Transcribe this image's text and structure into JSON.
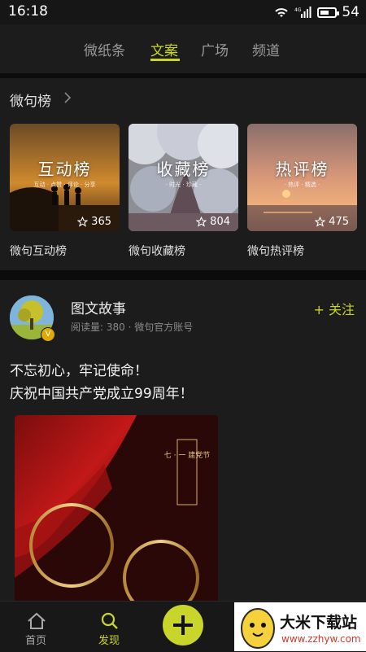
{
  "status": {
    "time": "16:18",
    "battery": "54",
    "net": "4G"
  },
  "tabs": [
    "微纸条",
    "文案",
    "广场",
    "频道"
  ],
  "active_tab": "文案",
  "section": {
    "title": "微句榜"
  },
  "cards": [
    {
      "art_title": "互动榜",
      "art_sub": "互动 · 点赞 · 评论 · 分享",
      "count": "365",
      "label": "微句互动榜"
    },
    {
      "art_title": "收藏榜",
      "art_sub": "· 时光 · 珍藏 ·",
      "count": "804",
      "label": "微句收藏榜"
    },
    {
      "art_title": "热评榜",
      "art_sub": "· 热评 · 精选 ·",
      "count": "475",
      "label": "微句热评榜"
    }
  ],
  "post": {
    "author": "图文故事",
    "meta": "阅读量: 380 · 微句官方账号",
    "follow": "+ 关注",
    "lines": [
      "不忘初心，牢记使命！",
      "庆祝中国共产党成立99周年！"
    ],
    "image_text": "七 · 一 建党节"
  },
  "bottom_nav": [
    {
      "label": "首页",
      "icon": "home-icon"
    },
    {
      "label": "发现",
      "icon": "search-icon"
    }
  ],
  "watermark": {
    "title": "大米下载站",
    "url": "www.zzhyw.com"
  },
  "colors": {
    "accent": "#c9d52a",
    "background": "#1c1c1c"
  }
}
